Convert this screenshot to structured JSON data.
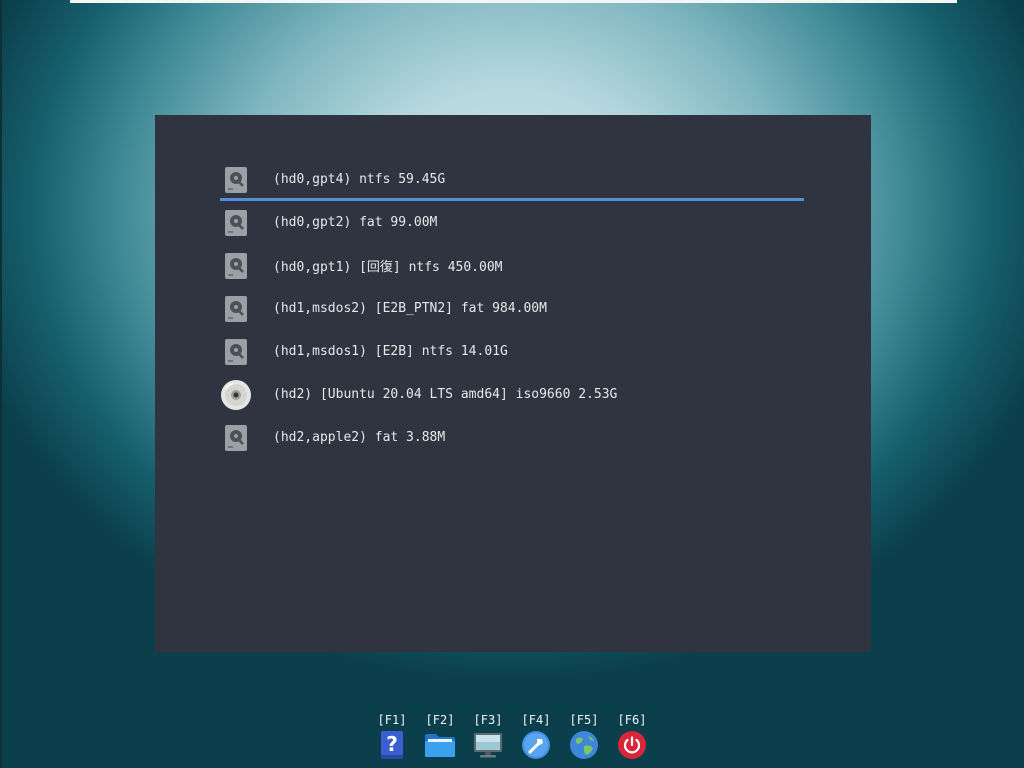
{
  "menu": {
    "entries": [
      {
        "label": "(hd0,gpt4) ntfs 59.45G",
        "icon": "hard-disk-icon",
        "selected": true
      },
      {
        "label": "(hd0,gpt2) fat 99.00M",
        "icon": "hard-disk-icon",
        "selected": false
      },
      {
        "label": "(hd0,gpt1) [回復] ntfs 450.00M",
        "icon": "hard-disk-icon",
        "selected": false
      },
      {
        "label": "(hd1,msdos2) [E2B_PTN2] fat 984.00M",
        "icon": "hard-disk-icon",
        "selected": false
      },
      {
        "label": "(hd1,msdos1) [E2B] ntfs 14.01G",
        "icon": "hard-disk-icon",
        "selected": false
      },
      {
        "label": "(hd2) [Ubuntu 20.04 LTS amd64] iso9660 2.53G",
        "icon": "optical-disc-icon",
        "selected": false
      },
      {
        "label": "(hd2,apple2) fat 3.88M",
        "icon": "hard-disk-icon",
        "selected": false
      }
    ]
  },
  "hotkeys": [
    {
      "label": "[F1]",
      "icon": "help-icon"
    },
    {
      "label": "[F2]",
      "icon": "folder-icon"
    },
    {
      "label": "[F3]",
      "icon": "display-icon"
    },
    {
      "label": "[F4]",
      "icon": "settings-wrench-icon"
    },
    {
      "label": "[F5]",
      "icon": "globe-icon"
    },
    {
      "label": "[F6]",
      "icon": "power-icon"
    }
  ],
  "colors": {
    "panel_background": "#2f3440",
    "selection_accent": "#4f8fdc",
    "text": "#e6e8ea"
  }
}
